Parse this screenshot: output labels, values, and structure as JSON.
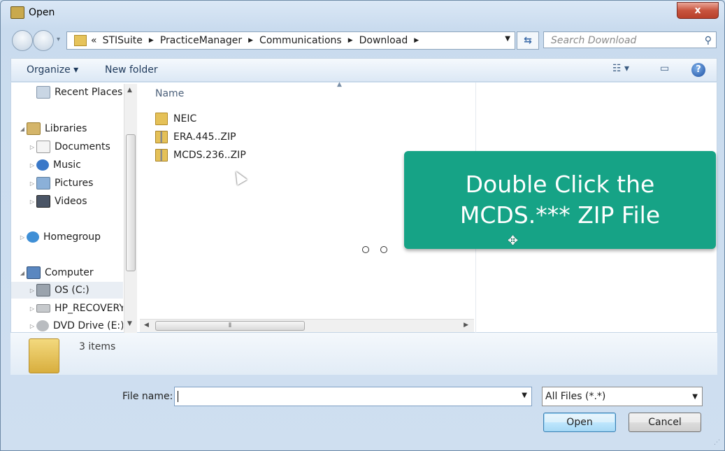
{
  "window": {
    "title": "Open",
    "close_label": "x"
  },
  "address": {
    "overflow": "«",
    "crumbs": [
      "STISuite",
      "PracticeManager",
      "Communications",
      "Download"
    ]
  },
  "search": {
    "placeholder": "Search Download"
  },
  "toolbar": {
    "organize": "Organize ▾",
    "new_folder": "New folder",
    "help": "?"
  },
  "nav": {
    "recent": "Recent Places",
    "libraries": "Libraries",
    "documents": "Documents",
    "music": "Music",
    "pictures": "Pictures",
    "videos": "Videos",
    "homegroup": "Homegroup",
    "computer": "Computer",
    "os": "OS (C:)",
    "recovery": "HP_RECOVERY",
    "dvd": "DVD Drive (E:) I"
  },
  "list": {
    "column_name": "Name",
    "files": [
      {
        "name": "NEIC",
        "type": "folder"
      },
      {
        "name": "ERA.445..ZIP",
        "type": "zip"
      },
      {
        "name": "MCDS.236..ZIP",
        "type": "zip"
      }
    ]
  },
  "details": {
    "count": "3 items"
  },
  "bottom": {
    "file_name_label": "File name:",
    "file_name_value": "",
    "filter": "All Files (*.*)",
    "open": "Open",
    "cancel": "Cancel"
  },
  "callout": {
    "line1": "Double Click the",
    "line2": "MCDS.*** ZIP File",
    "color": "#16a386"
  }
}
